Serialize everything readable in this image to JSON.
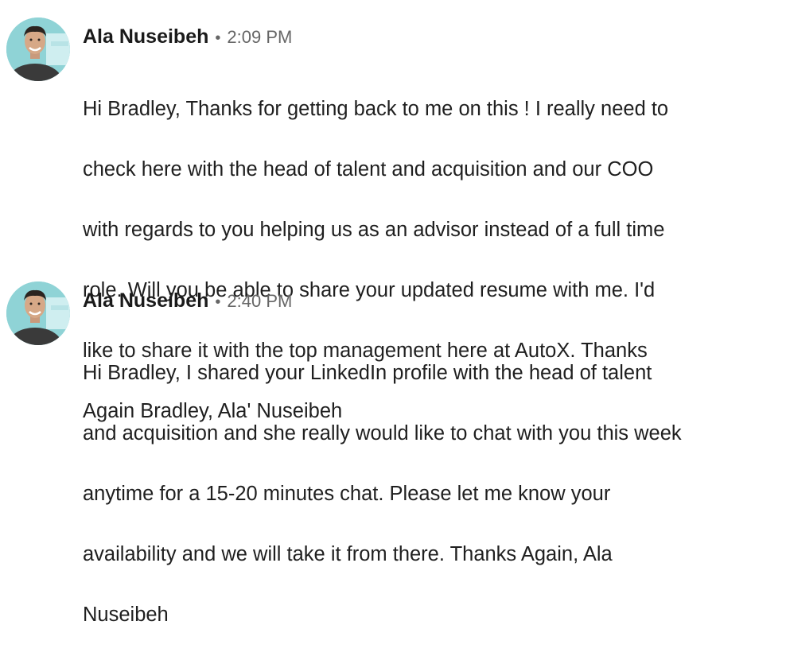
{
  "messages": [
    {
      "sender": "Ala Nuseibeh",
      "separator": "•",
      "time": "2:09 PM",
      "avatar_icon": "profile-photo",
      "body_lines": [
        "Hi Bradley, Thanks for getting back to me on this ! I really need to",
        "check here with the head of talent and acquisition and our COO",
        "with regards to you helping us as an advisor instead of a full time",
        "role. Will you be able to share your updated resume with me. I'd",
        "like to share it with the top management here at AutoX. Thanks",
        "Again Bradley, Ala' Nuseibeh"
      ]
    },
    {
      "sender": "Ala Nuseibeh",
      "separator": "•",
      "time": "2:40 PM",
      "avatar_icon": "profile-photo",
      "body_lines": [
        "Hi Bradley, I shared your LinkedIn profile with the head of talent",
        "and acquisition and she really would like to chat with you this week",
        "anytime for a 15-20 minutes chat. Please let me know your",
        "availability and we will take it from there. Thanks Again, Ala",
        "Nuseibeh"
      ]
    }
  ],
  "colors": {
    "text": "#1f1f1f",
    "meta": "#666666",
    "avatar_bg": "#8fd3d6"
  }
}
